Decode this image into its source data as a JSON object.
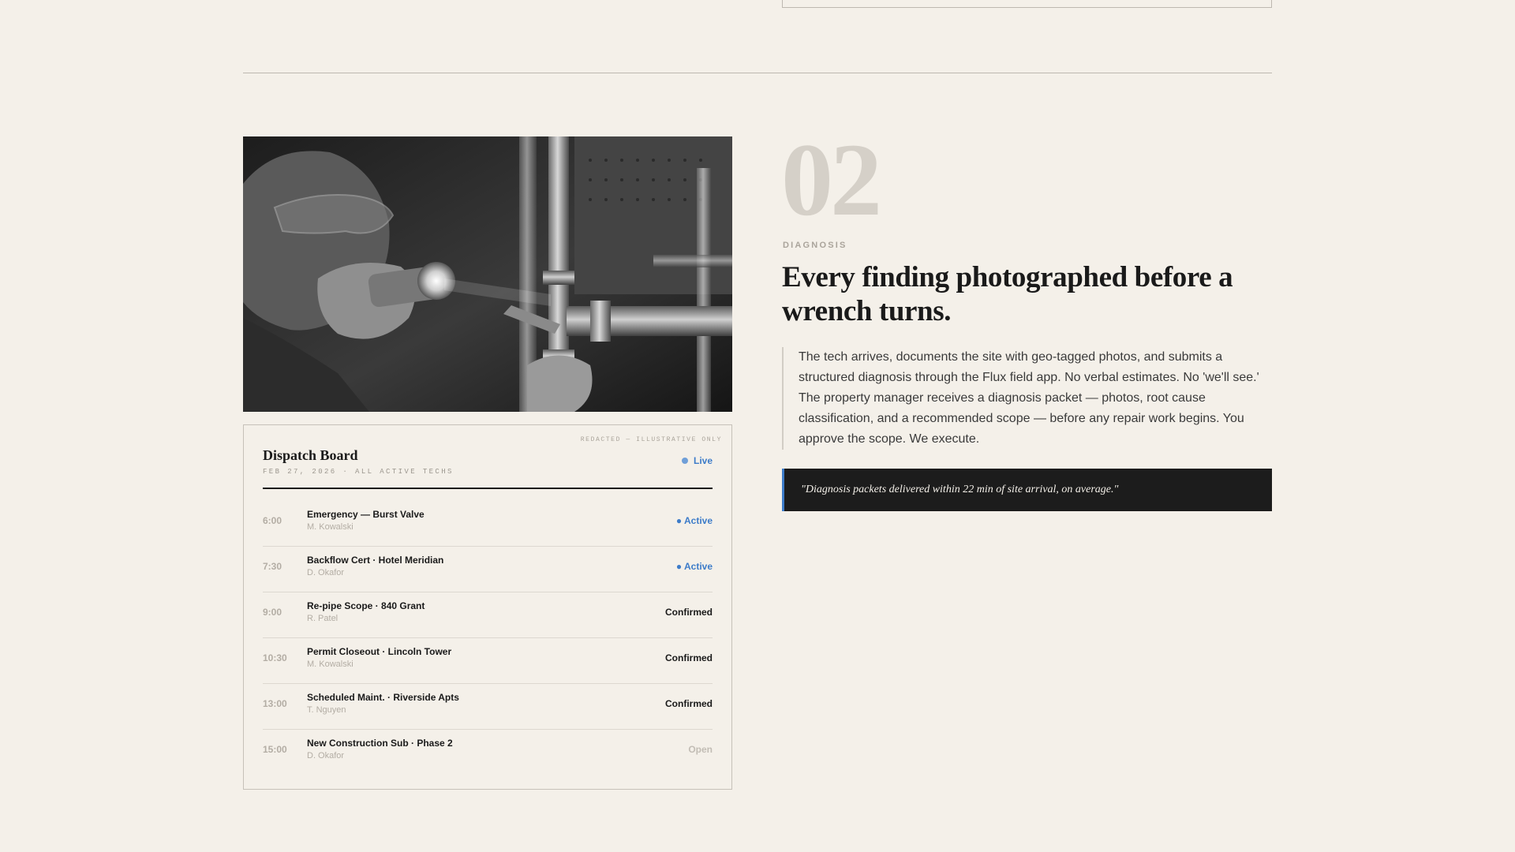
{
  "step": {
    "number": "02",
    "label": "DIAGNOSIS",
    "heading": "Every finding photographed before a wrench turns.",
    "body": "The tech arrives, documents the site with geo-tagged photos, and submits a structured diagnosis through the Flux field app. No verbal estimates. No 'we'll see.' The property manager receives a diagnosis packet — photos, root cause classification, and a recommended scope — before any repair work begins. You approve the scope. We execute.",
    "callout": "\"Diagnosis packets delivered within 22 min of site arrival, on average.\""
  },
  "board": {
    "watermark": "REDACTED — ILLUSTRATIVE ONLY",
    "title": "Dispatch Board",
    "subtitle": "FEB 27, 2026 · ALL ACTIVE TECHS",
    "live_label": "Live",
    "rows": [
      {
        "time": "6:00",
        "title": "Emergency — Burst Valve",
        "tech": "M. Kowalski",
        "status": "● Active"
      },
      {
        "time": "7:30",
        "title": "Backflow Cert · Hotel Meridian",
        "tech": "D. Okafor",
        "status": "● Active"
      },
      {
        "time": "9:00",
        "title": "Re-pipe Scope · 840 Grant",
        "tech": "R. Patel",
        "status": "Confirmed"
      },
      {
        "time": "10:30",
        "title": "Permit Closeout · Lincoln Tower",
        "tech": "M. Kowalski",
        "status": "Confirmed"
      },
      {
        "time": "13:00",
        "title": "Scheduled Maint. · Riverside Apts",
        "tech": "T. Nguyen",
        "status": "Confirmed"
      },
      {
        "time": "15:00",
        "title": "New Construction Sub · Phase 2",
        "tech": "D. Okafor",
        "status": "Open"
      }
    ]
  },
  "colors": {
    "background": "#f4f0e9",
    "accent": "#3d7cc9",
    "callout_bg": "#1c1c1c"
  }
}
